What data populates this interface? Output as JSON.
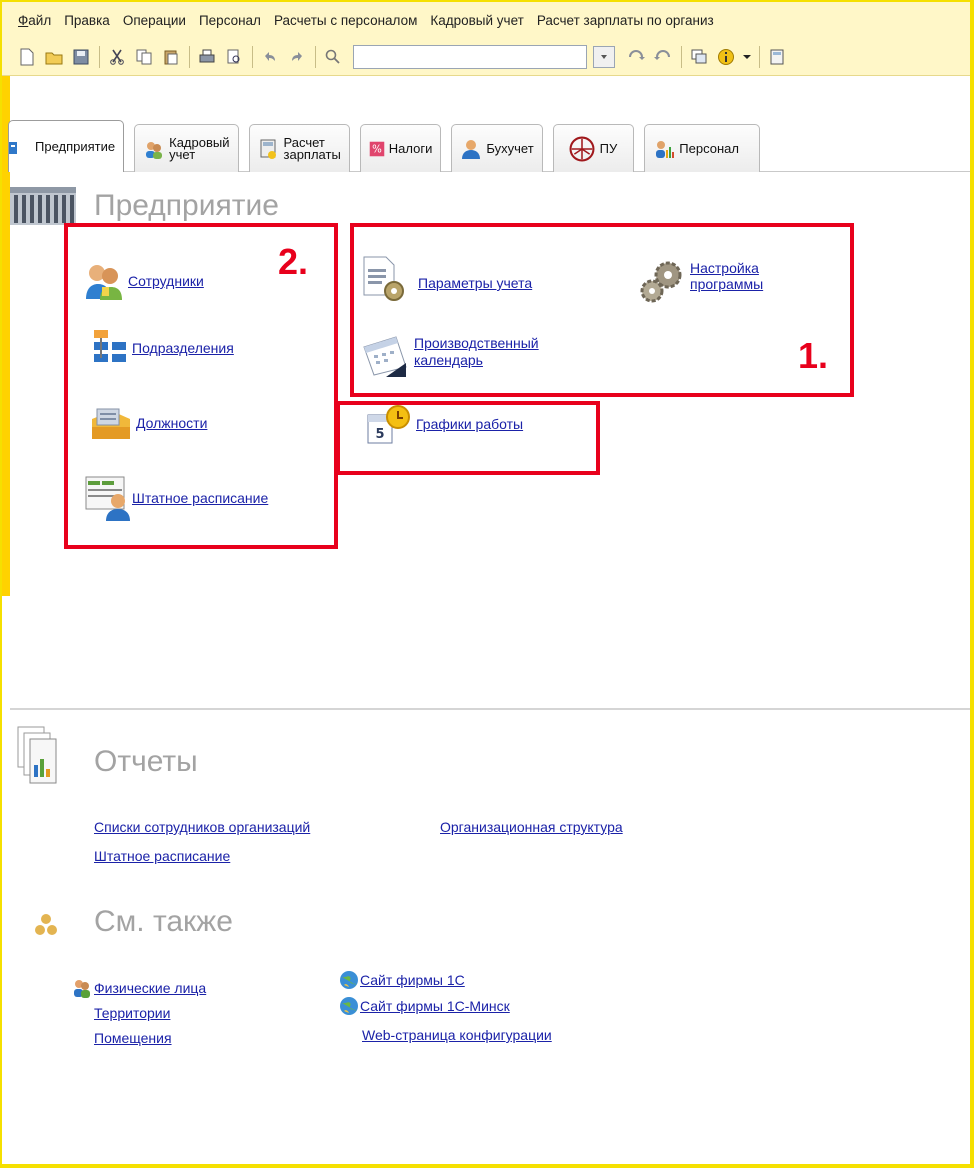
{
  "menu": [
    "Файл",
    "Правка",
    "Операции",
    "Персонал",
    "Расчеты с персоналом",
    "Кадровый учет",
    "Расчет зарплаты по организ"
  ],
  "tabs": [
    {
      "label": "Предприятие",
      "icon": "enterprise-icon"
    },
    {
      "label1": "Кадровый",
      "label2": "учет",
      "icon": "people-icon"
    },
    {
      "label1": "Расчет",
      "label2": "зарплаты",
      "icon": "calculator-icon"
    },
    {
      "label": "Налоги",
      "icon": "percent-icon"
    },
    {
      "label": "Бухучет",
      "icon": "accountant-icon"
    },
    {
      "label": "ПУ",
      "icon": "emblem-icon"
    },
    {
      "label": "Персонал",
      "icon": "personnel-icon"
    }
  ],
  "enterprise": {
    "title": "Предприятие",
    "employees": "Сотрудники",
    "departments": "Подразделения",
    "positions": "Должности",
    "staffing": "Штатное расписание",
    "accounting_params": "Параметры учета",
    "program_setup_1": "Настройка",
    "program_setup_2": "программы",
    "calendar_1": "Производственный",
    "calendar_2": "календарь",
    "schedules": "Графики работы"
  },
  "annotations": {
    "box1": "1.",
    "box2": "2."
  },
  "reports": {
    "title": "Отчеты",
    "lists": "Списки сотрудников организаций",
    "org_structure": "Организационная структура",
    "staffing": "Штатное расписание"
  },
  "see_also": {
    "title": "См. также",
    "individuals": "Физические лица",
    "territories": "Территории",
    "rooms": "Помещения",
    "site_1c": "Сайт фирмы 1С",
    "site_1c_minsk": "Сайт фирмы 1С-Минск",
    "config_page": "Web-страница конфигурации"
  },
  "colors": {
    "link": "#1b22a8",
    "annotation_red": "#e8001c",
    "toolbar_bg": "#fff7c8",
    "frame_yellow": "#f5e000"
  }
}
